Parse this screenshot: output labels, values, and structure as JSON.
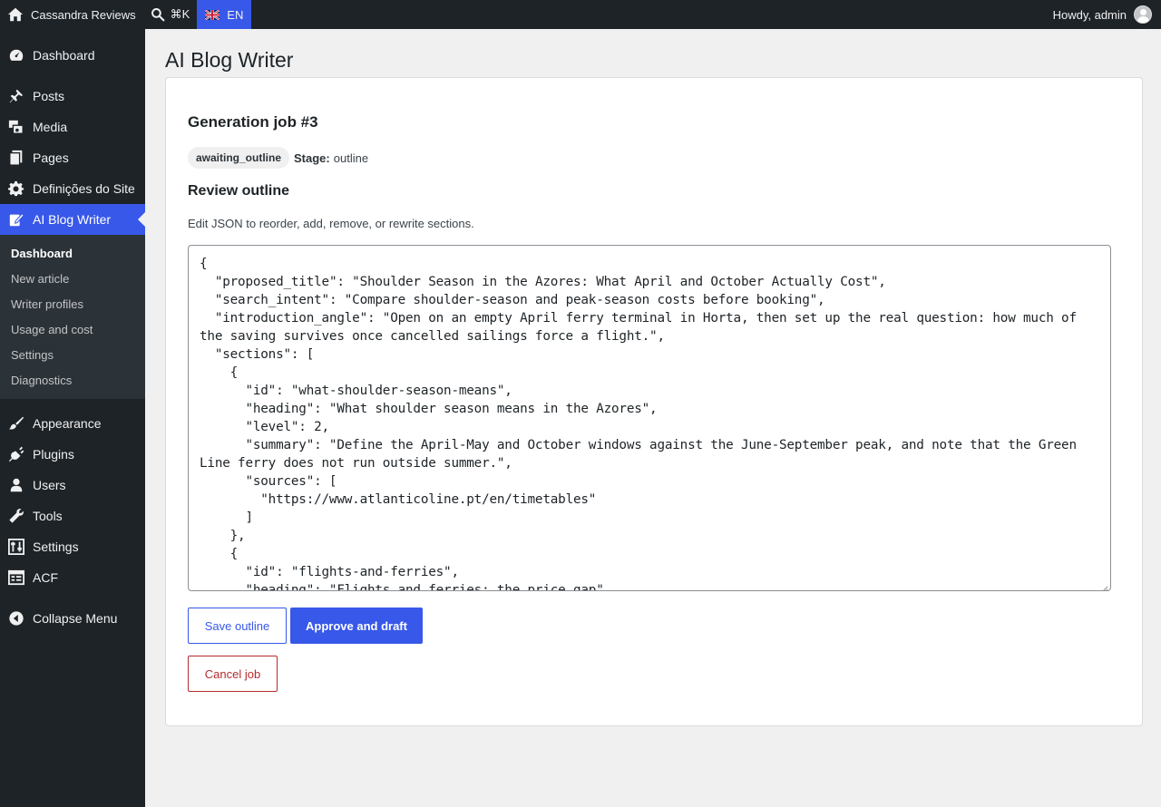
{
  "admin_bar": {
    "site_name": "Cassandra Reviews",
    "search_shortcut": "⌘K",
    "language": "EN",
    "greeting": "Howdy, admin"
  },
  "sidebar": {
    "items_top": [
      {
        "label": "Dashboard",
        "icon": "dashboard-icon"
      },
      {
        "label": "Posts",
        "icon": "pin-icon"
      },
      {
        "label": "Media",
        "icon": "media-icon"
      },
      {
        "label": "Pages",
        "icon": "pages-icon"
      },
      {
        "label": "Definições do Site",
        "icon": "gear-icon"
      },
      {
        "label": "AI Blog Writer",
        "icon": "edit-page-icon"
      }
    ],
    "submenu": [
      "Dashboard",
      "New article",
      "Writer profiles",
      "Usage and cost",
      "Settings",
      "Diagnostics"
    ],
    "items_bottom": [
      {
        "label": "Appearance",
        "icon": "brush-icon"
      },
      {
        "label": "Plugins",
        "icon": "plug-icon"
      },
      {
        "label": "Users",
        "icon": "user-icon"
      },
      {
        "label": "Tools",
        "icon": "wrench-icon"
      },
      {
        "label": "Settings",
        "icon": "sliders-icon"
      },
      {
        "label": "ACF",
        "icon": "table-icon"
      },
      {
        "label": "Collapse Menu",
        "icon": "collapse-icon"
      }
    ]
  },
  "main": {
    "page_title": "AI Blog Writer",
    "job_title": "Generation job #3",
    "status": "awaiting_outline",
    "stage_label": "Stage:",
    "stage_value": "outline",
    "review_title": "Review outline",
    "review_desc": "Edit JSON to reorder, add, remove, or rewrite sections.",
    "outline_json": "{\n  \"proposed_title\": \"Shoulder Season in the Azores: What April and October Actually Cost\",\n  \"search_intent\": \"Compare shoulder-season and peak-season costs before booking\",\n  \"introduction_angle\": \"Open on an empty April ferry terminal in Horta, then set up the real question: how much of the saving survives once cancelled sailings force a flight.\",\n  \"sections\": [\n    {\n      \"id\": \"what-shoulder-season-means\",\n      \"heading\": \"What shoulder season means in the Azores\",\n      \"level\": 2,\n      \"summary\": \"Define the April-May and October windows against the June-September peak, and note that the Green Line ferry does not run outside summer.\",\n      \"sources\": [\n        \"https://www.atlanticoline.pt/en/timetables\"\n      ]\n    },\n    {\n      \"id\": \"flights-and-ferries\",\n      \"heading\": \"Flights and ferries: the price gap\",",
    "buttons": {
      "save": "Save outline",
      "approve": "Approve and draft",
      "cancel": "Cancel job"
    }
  },
  "colors": {
    "accent": "#3858e9",
    "danger": "#b32d2e",
    "sidebar_bg": "#1d2327"
  }
}
